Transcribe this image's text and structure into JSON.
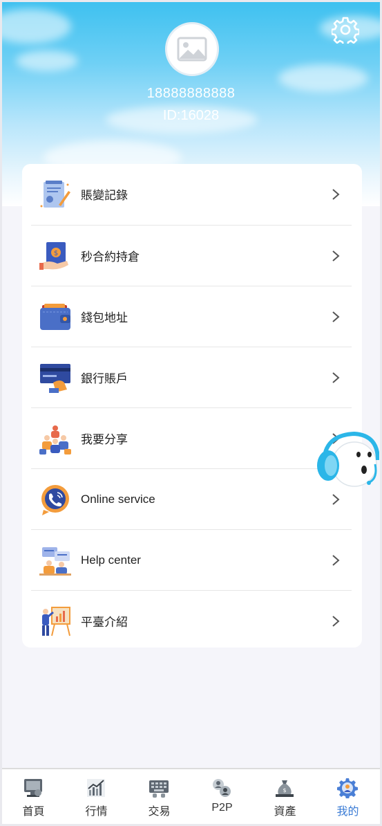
{
  "profile": {
    "phone": "18888888888",
    "id_label": "ID:16028"
  },
  "menu": [
    {
      "label": "賬變記錄",
      "icon": "ledger-icon"
    },
    {
      "label": "秒合約持倉",
      "icon": "contract-icon"
    },
    {
      "label": "錢包地址",
      "icon": "wallet-icon"
    },
    {
      "label": "銀行賬戶",
      "icon": "bank-card-icon"
    },
    {
      "label": "我要分享",
      "icon": "share-people-icon"
    },
    {
      "label": "Online service",
      "icon": "phone-call-icon"
    },
    {
      "label": "Help center",
      "icon": "help-chat-icon"
    },
    {
      "label": "平臺介紹",
      "icon": "presentation-icon"
    }
  ],
  "tabs": [
    {
      "label": "首頁",
      "icon": "home-monitor-icon",
      "active": false
    },
    {
      "label": "行情",
      "icon": "market-chart-icon",
      "active": false
    },
    {
      "label": "交易",
      "icon": "keyboard-icon",
      "active": false
    },
    {
      "label": "P2P",
      "icon": "p2p-users-icon",
      "active": false
    },
    {
      "label": "資產",
      "icon": "money-bag-icon",
      "active": false
    },
    {
      "label": "我的",
      "icon": "settings-gear-icon",
      "active": true
    }
  ],
  "colors": {
    "accent": "#3a7bd5",
    "sky_top": "#3ec1f0",
    "background": "#f5f5fa"
  }
}
